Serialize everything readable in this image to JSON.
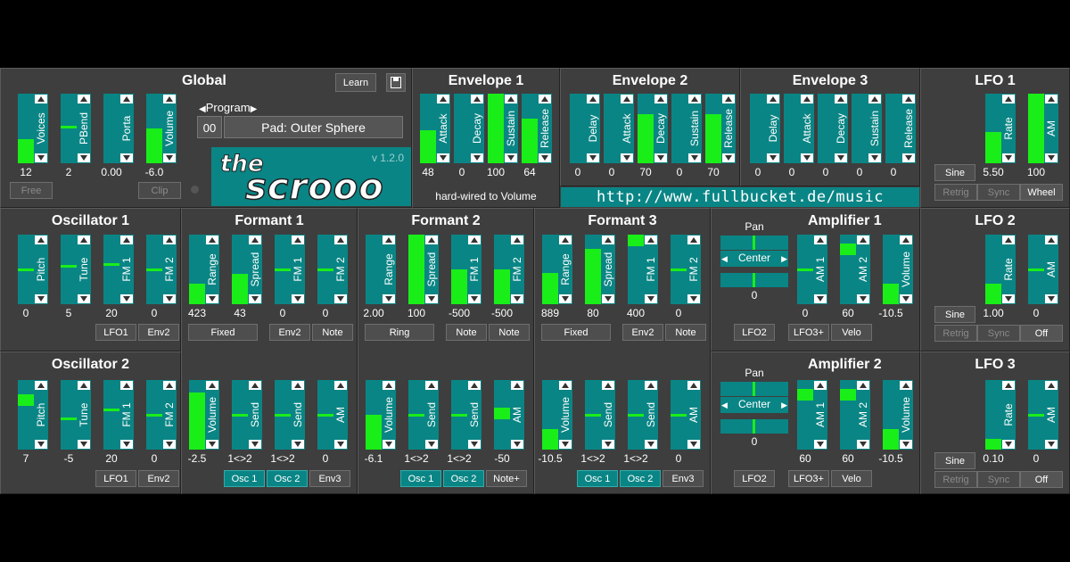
{
  "global": {
    "title": "Global",
    "learn_label": "Learn",
    "program_label": "Program",
    "program_number": "00",
    "program_name": "Pad: Outer Sphere",
    "free_label": "Free",
    "clip_label": "Clip",
    "sliders": [
      {
        "label": "Voices",
        "value": "12",
        "level": 0.34
      },
      {
        "label": "PBend",
        "value": "2",
        "level": 0.52,
        "mode": "mark"
      },
      {
        "label": "Porta",
        "value": "0.00",
        "level": 0.0
      },
      {
        "label": "Volume",
        "value": "-6.0",
        "level": 0.5
      }
    ]
  },
  "logo": {
    "word1": "the",
    "word2": "scrooo",
    "version": "v 1.2.0"
  },
  "envelope1": {
    "title": "Envelope 1",
    "note": "hard-wired to Volume",
    "sliders": [
      {
        "label": "Attack",
        "value": "48",
        "level": 0.48
      },
      {
        "label": "Decay",
        "value": "0",
        "level": 0.0
      },
      {
        "label": "Sustain",
        "value": "100",
        "level": 1.0
      },
      {
        "label": "Release",
        "value": "64",
        "level": 0.64
      }
    ]
  },
  "envelope2": {
    "title": "Envelope 2",
    "sliders": [
      {
        "label": "Delay",
        "value": "0",
        "level": 0.0
      },
      {
        "label": "Attack",
        "value": "0",
        "level": 0.0
      },
      {
        "label": "Decay",
        "value": "70",
        "level": 0.7
      },
      {
        "label": "Sustain",
        "value": "0",
        "level": 0.0
      },
      {
        "label": "Release",
        "value": "70",
        "level": 0.7
      }
    ]
  },
  "envelope3": {
    "title": "Envelope 3",
    "sliders": [
      {
        "label": "Delay",
        "value": "0",
        "level": 0.0
      },
      {
        "label": "Attack",
        "value": "0",
        "level": 0.0
      },
      {
        "label": "Decay",
        "value": "0",
        "level": 0.0
      },
      {
        "label": "Sustain",
        "value": "0",
        "level": 0.0
      },
      {
        "label": "Release",
        "value": "0",
        "level": 0.0
      }
    ]
  },
  "url": "http://www.fullbucket.de/music",
  "lfo1": {
    "title": "LFO 1",
    "wave_label": "Sine",
    "retrig_label": "Retrig",
    "sync_label": "Sync",
    "mod_label": "Wheel",
    "sliders": [
      {
        "label": "Rate",
        "value": "5.50",
        "level": 0.45
      },
      {
        "label": "AM",
        "value": "100",
        "level": 1.0
      }
    ]
  },
  "lfo2": {
    "title": "LFO 2",
    "wave_label": "Sine",
    "retrig_label": "Retrig",
    "sync_label": "Sync",
    "mod_label": "Off",
    "sliders": [
      {
        "label": "Rate",
        "value": "1.00",
        "level": 0.3
      },
      {
        "label": "AM",
        "value": "0",
        "level": 0.5,
        "mode": "mark"
      }
    ]
  },
  "lfo3": {
    "title": "LFO 3",
    "wave_label": "Sine",
    "retrig_label": "Retrig",
    "sync_label": "Sync",
    "mod_label": "Off",
    "sliders": [
      {
        "label": "Rate",
        "value": "0.10",
        "level": 0.15
      },
      {
        "label": "AM",
        "value": "0",
        "level": 0.5,
        "mode": "mark"
      }
    ]
  },
  "osc1": {
    "title": "Oscillator 1",
    "btn1": "LFO1",
    "btn2": "Env2",
    "sliders": [
      {
        "label": "Pitch",
        "value": "0",
        "level": 0.5,
        "mode": "mark"
      },
      {
        "label": "Tune",
        "value": "5",
        "level": 0.55,
        "mode": "mark"
      },
      {
        "label": "FM 1",
        "value": "20",
        "level": 0.58,
        "mode": "mark"
      },
      {
        "label": "FM 2",
        "value": "0",
        "level": 0.5,
        "mode": "mark"
      }
    ]
  },
  "osc2": {
    "title": "Oscillator 2",
    "btn1": "LFO1",
    "btn2": "Env2",
    "sliders": [
      {
        "label": "Pitch",
        "value": "7",
        "level": 0.72,
        "mode": "block"
      },
      {
        "label": "Tune",
        "value": "-5",
        "level": 0.45,
        "mode": "mark"
      },
      {
        "label": "FM 1",
        "value": "20",
        "level": 0.58,
        "mode": "mark"
      },
      {
        "label": "FM 2",
        "value": "0",
        "level": 0.5,
        "mode": "mark"
      }
    ]
  },
  "formant1": {
    "title": "Formant 1",
    "btn_mode": "Fixed",
    "btn_a": "Env2",
    "btn_b": "Note",
    "sliders": [
      {
        "label": "Range",
        "value": "423",
        "level": 0.3
      },
      {
        "label": "Spread",
        "value": "43",
        "level": 0.43
      },
      {
        "label": "FM 1",
        "value": "0",
        "level": 0.5,
        "mode": "mark"
      },
      {
        "label": "FM 2",
        "value": "0",
        "level": 0.5,
        "mode": "mark"
      }
    ],
    "lower": {
      "btn_a": "Osc 1",
      "btn_b": "Osc 2",
      "btn_c": "Env3",
      "sliders": [
        {
          "label": "Volume",
          "value": "-2.5",
          "level": 0.82
        },
        {
          "label": "Send",
          "value": "1<>2",
          "level": 0.5,
          "mode": "mark"
        },
        {
          "label": "Send",
          "value": "1<>2",
          "level": 0.5,
          "mode": "mark"
        },
        {
          "label": "AM",
          "value": "0",
          "level": 0.5,
          "mode": "mark"
        }
      ]
    }
  },
  "formant2": {
    "title": "Formant 2",
    "btn_mode": "Ring",
    "btn_a": "Note",
    "btn_b": "Note",
    "sliders": [
      {
        "label": "Range",
        "value": "2.00",
        "level": 0.0
      },
      {
        "label": "Spread",
        "value": "100",
        "level": 1.0
      },
      {
        "label": "FM 1",
        "value": "-500",
        "level": 0.5
      },
      {
        "label": "FM 2",
        "value": "-500",
        "level": 0.5
      }
    ],
    "lower": {
      "btn_a": "Osc 1",
      "btn_b": "Osc 2",
      "btn_c": "Note+",
      "sliders": [
        {
          "label": "Volume",
          "value": "-6.1",
          "level": 0.5
        },
        {
          "label": "Send",
          "value": "1<>2",
          "level": 0.5,
          "mode": "mark"
        },
        {
          "label": "Send",
          "value": "1<>2",
          "level": 0.5,
          "mode": "mark"
        },
        {
          "label": "AM",
          "value": "-50",
          "level": 0.52,
          "mode": "block"
        }
      ]
    }
  },
  "formant3": {
    "title": "Formant 3",
    "btn_mode": "Fixed",
    "btn_a": "Env2",
    "btn_b": "Note",
    "sliders": [
      {
        "label": "Range",
        "value": "889",
        "level": 0.45
      },
      {
        "label": "Spread",
        "value": "80",
        "level": 0.8
      },
      {
        "label": "FM 1",
        "value": "400",
        "level": 0.92,
        "mode": "block"
      },
      {
        "label": "FM 2",
        "value": "0",
        "level": 0.5,
        "mode": "mark"
      }
    ],
    "lower": {
      "btn_a": "Osc 1",
      "btn_b": "Osc 2",
      "btn_c": "Env3",
      "sliders": [
        {
          "label": "Volume",
          "value": "-10.5",
          "level": 0.3
        },
        {
          "label": "Send",
          "value": "1<>2",
          "level": 0.5,
          "mode": "mark"
        },
        {
          "label": "Send",
          "value": "1<>2",
          "level": 0.5,
          "mode": "mark"
        },
        {
          "label": "AM",
          "value": "0",
          "level": 0.5,
          "mode": "mark"
        }
      ]
    }
  },
  "amp1": {
    "title": "Amplifier 1",
    "pan_label": "Pan",
    "pan_value": "Center",
    "pan2_value": "0",
    "btn_a": "LFO2",
    "btn_b": "LFO3+",
    "btn_c": "Velo",
    "sliders": [
      {
        "label": "AM 1",
        "value": "0",
        "level": 0.5,
        "mode": "mark"
      },
      {
        "label": "AM 2",
        "value": "60",
        "level": 0.8,
        "mode": "block"
      },
      {
        "label": "Volume",
        "value": "-10.5",
        "level": 0.3
      }
    ]
  },
  "amp2": {
    "title": "Amplifier 2",
    "pan_label": "Pan",
    "pan_value": "Center",
    "pan2_value": "0",
    "btn_a": "LFO2",
    "btn_b": "LFO3+",
    "btn_c": "Velo",
    "sliders": [
      {
        "label": "AM 1",
        "value": "60",
        "level": 0.8,
        "mode": "block"
      },
      {
        "label": "AM 2",
        "value": "60",
        "level": 0.8,
        "mode": "block"
      },
      {
        "label": "Volume",
        "value": "-10.5",
        "level": 0.3
      }
    ]
  },
  "colors": {
    "background": "#3e3e3e",
    "teal": "#0a8585",
    "green": "#19ee19"
  }
}
